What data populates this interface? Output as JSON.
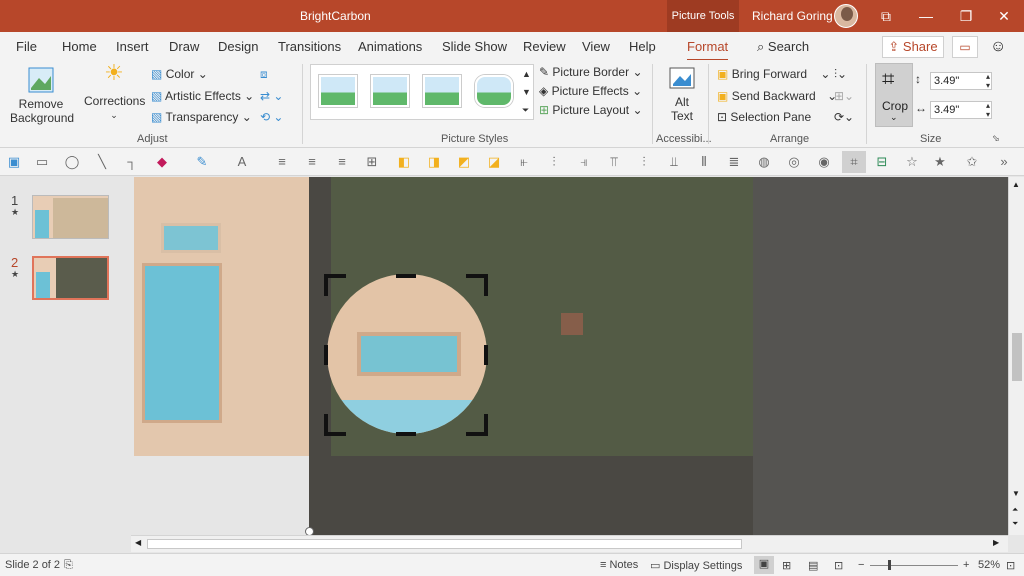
{
  "titlebar": {
    "app_title": "BrightCarbon",
    "picture_tools": "Picture Tools",
    "user_name": "Richard Goring"
  },
  "menu": {
    "tabs": [
      "File",
      "Home",
      "Insert",
      "Draw",
      "Design",
      "Transitions",
      "Animations",
      "Slide Show",
      "Review",
      "View",
      "Help",
      "Format"
    ],
    "active_tab": "Format",
    "search_label": "Search",
    "share_label": "Share"
  },
  "ribbon": {
    "remove_background": [
      "Remove",
      "Background"
    ],
    "corrections": "Corrections",
    "color": "Color",
    "artistic_effects": "Artistic Effects",
    "transparency": "Transparency",
    "adjust_group": "Adjust",
    "picture_border": "Picture Border",
    "picture_effects": "Picture Effects",
    "picture_layout": "Picture Layout",
    "picture_styles_group": "Picture Styles",
    "alt_text": [
      "Alt",
      "Text"
    ],
    "accessibility_group": "Accessibi...",
    "bring_forward": "Bring Forward",
    "send_backward": "Send Backward",
    "selection_pane": "Selection Pane",
    "arrange_group": "Arrange",
    "crop": "Crop",
    "height": "3.49\"",
    "width": "3.49\"",
    "size_group": "Size"
  },
  "slides": {
    "items": [
      {
        "number": "1"
      },
      {
        "number": "2"
      }
    ],
    "selected": 2
  },
  "status": {
    "slide_info": "Slide 2 of 2",
    "notes": "Notes",
    "display_settings": "Display Settings",
    "zoom": "52%"
  },
  "colors": {
    "accent": "#b7472a"
  }
}
